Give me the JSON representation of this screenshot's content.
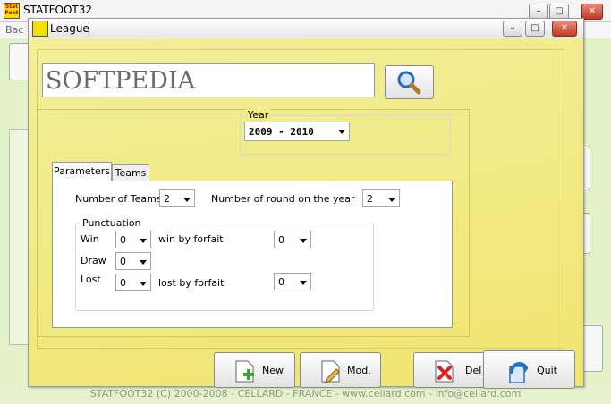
{
  "main": {
    "title": "STATFOOT32",
    "menu_partial": "Bac",
    "status_bar": "STATFOOT32 (C) 2000-2008 - CELLARD - FRANCE - www.cellard.com - info@cellard.com",
    "icon_text": "Stat Foot"
  },
  "dialog": {
    "title": "League",
    "search": {
      "value": "SOFTPEDIA"
    },
    "year": {
      "label": "Year",
      "value": "2009 - 2010"
    },
    "tabs": [
      {
        "label": "Parameters",
        "active": true
      },
      {
        "label": "Teams",
        "active": false
      }
    ],
    "parameters": {
      "number_of_teams": {
        "label": "Number of Teams",
        "value": "2"
      },
      "number_of_rounds": {
        "label": "Number of round on the year",
        "value": "2"
      },
      "punctuation": {
        "label": "Punctuation",
        "win": {
          "label": "Win",
          "value": "0"
        },
        "win_by_forfait": {
          "label": "win by forfait",
          "value": "0"
        },
        "draw": {
          "label": "Draw",
          "value": "0"
        },
        "lost": {
          "label": "Lost",
          "value": "0"
        },
        "lost_by_forfait": {
          "label": "lost by forfait",
          "value": "0"
        }
      }
    },
    "buttons": {
      "new": "New",
      "mod": "Mod.",
      "del": "Del",
      "quit": "Quit"
    }
  },
  "colors": {
    "dialog_bg": "#f1eb86",
    "main_bg": "#e3f2c9",
    "close_button": "#c33a22"
  }
}
